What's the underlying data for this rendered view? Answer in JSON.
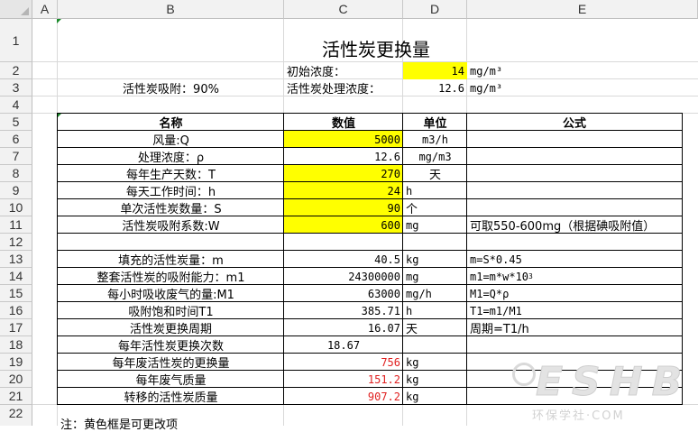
{
  "columns": [
    "A",
    "B",
    "C",
    "D",
    "E"
  ],
  "rows": [
    "1",
    "2",
    "3",
    "4",
    "5",
    "6",
    "7",
    "8",
    "9",
    "10",
    "11",
    "12",
    "13",
    "14",
    "15",
    "16",
    "17",
    "18",
    "19",
    "20",
    "21",
    "22"
  ],
  "title": "活性炭更换量",
  "header_info": {
    "initial_conc_label": "初始浓度：",
    "initial_conc_value": "14",
    "initial_conc_unit": "mg/m³",
    "adsorption_label": "活性炭吸附：90%",
    "treated_conc_label": "活性炭处理浓度：",
    "treated_conc_value": "12.6",
    "treated_conc_unit": "mg/m³"
  },
  "table": {
    "headers": [
      "名称",
      "数值",
      "单位",
      "公式"
    ],
    "rows": [
      {
        "name": "风量:Q",
        "value": "5000",
        "unit": "m3/h",
        "formula": ""
      },
      {
        "name": "处理浓度：ρ",
        "value": "12.6",
        "unit": "mg/m3",
        "formula": ""
      },
      {
        "name": "每年生产天数：T",
        "value": "270",
        "unit": "天",
        "formula": ""
      },
      {
        "name": "每天工作时间：h",
        "value": "24",
        "unit": "h",
        "formula": ""
      },
      {
        "name": "单次活性炭数量：S",
        "value": "90",
        "unit": "个",
        "formula": ""
      },
      {
        "name": "活性炭吸附系数:W",
        "value": "600",
        "unit": "mg",
        "formula": "可取550-600mg（根据碘吸附值）"
      },
      {
        "name": "",
        "value": "",
        "unit": "",
        "formula": ""
      },
      {
        "name": "填充的活性炭量：m",
        "value": "40.5",
        "unit": "kg",
        "formula": "m=S*0.45"
      },
      {
        "name": "整套活性炭的吸附能力：m1",
        "value": "24300000",
        "unit": "mg",
        "formula": "m1=m*w*10",
        "formula_sup": "3"
      },
      {
        "name": "每小时吸收废气的量:M1",
        "value": "63000",
        "unit": "mg/h",
        "formula": "M1=Q*ρ"
      },
      {
        "name": "吸附饱和时间T1",
        "value": "385.71",
        "unit": "h",
        "formula": "T1=m1/M1"
      },
      {
        "name": "活性炭更换周期",
        "value": "16.07",
        "unit": "天",
        "formula": "周期=T1/h"
      },
      {
        "name": "每年活性炭更换次数",
        "value": "18.67",
        "unit": "",
        "formula": ""
      },
      {
        "name": "每年废活性炭的更换量",
        "value": "756",
        "unit": "kg",
        "formula": ""
      },
      {
        "name": "每年废气质量",
        "value": "151.2",
        "unit": "kg",
        "formula": ""
      },
      {
        "name": "转移的活性炭质量",
        "value": "907.2",
        "unit": "kg",
        "formula": ""
      }
    ]
  },
  "note": "注：黄色框是可更改项",
  "watermark": {
    "big": "ESHB",
    "small": "环保学社·COM",
    "logo": "环保"
  },
  "colors": {
    "highlight": "#ffff00",
    "red_value": "#e02020",
    "gridline": "#d9d9d9",
    "header_bg": "#f2f2f2"
  }
}
